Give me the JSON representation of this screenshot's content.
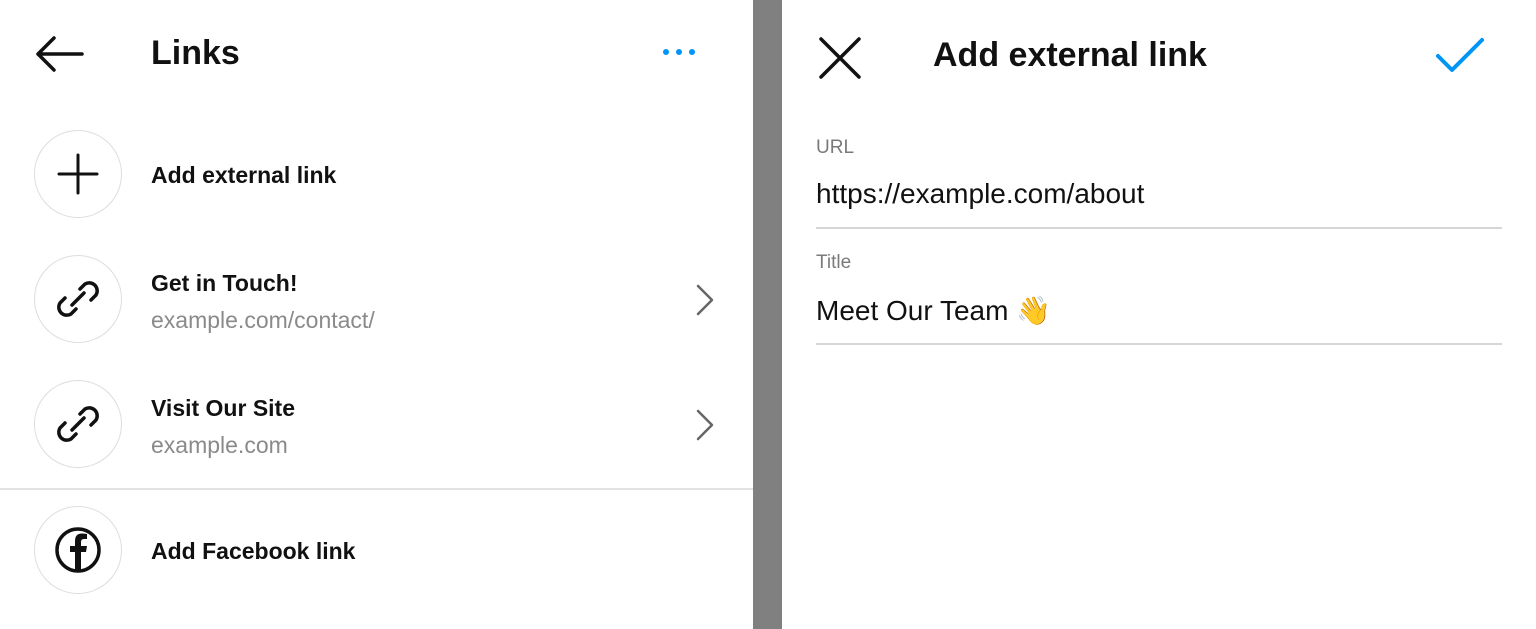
{
  "links_screen": {
    "title": "Links",
    "items": [
      {
        "title": "Add external link"
      },
      {
        "title": "Get in Touch!",
        "subtitle": "example.com/contact/"
      },
      {
        "title": "Visit Our Site",
        "subtitle": "example.com"
      },
      {
        "title": "Add Facebook link"
      }
    ],
    "icons": {
      "back": "arrow-left-icon",
      "more": "more-dots-icon",
      "add": "plus-icon",
      "link": "link-icon",
      "facebook": "facebook-icon",
      "chevron": "chevron-right-icon"
    }
  },
  "add_link_screen": {
    "title": "Add external link",
    "url_label": "URL",
    "url_value": "https://example.com/about",
    "title_label": "Title",
    "title_value": "Meet Our Team 👋",
    "icons": {
      "close": "close-icon",
      "confirm": "checkmark-icon"
    }
  },
  "colors": {
    "accent": "#0095f6",
    "text": "#111111",
    "secondary_text": "#8a8a8a",
    "divider": "#808080"
  }
}
